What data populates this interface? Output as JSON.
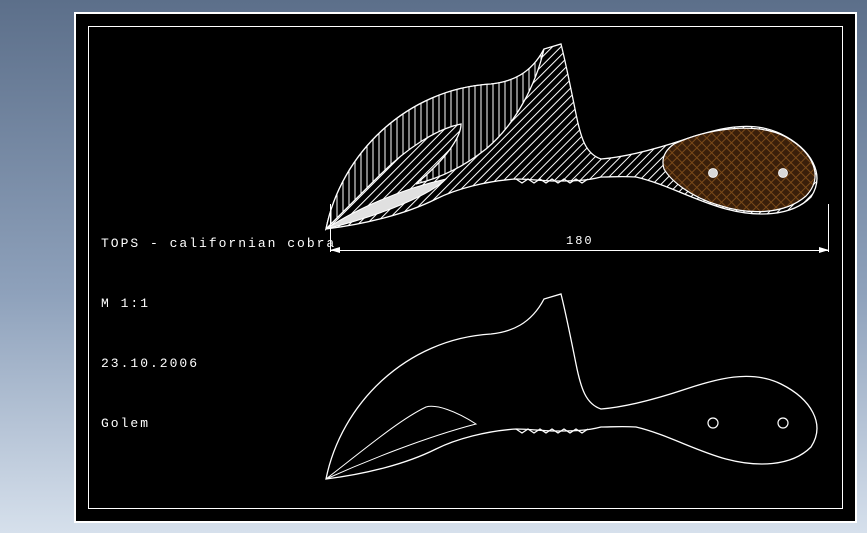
{
  "title_block": {
    "line1": "TOPS - californian cobra",
    "line2": "M 1:1",
    "line3": "23.10.2006",
    "line4": "Golem"
  },
  "dimension": {
    "length_label": "180"
  },
  "drawing": {
    "object": "knife",
    "views": 2
  }
}
